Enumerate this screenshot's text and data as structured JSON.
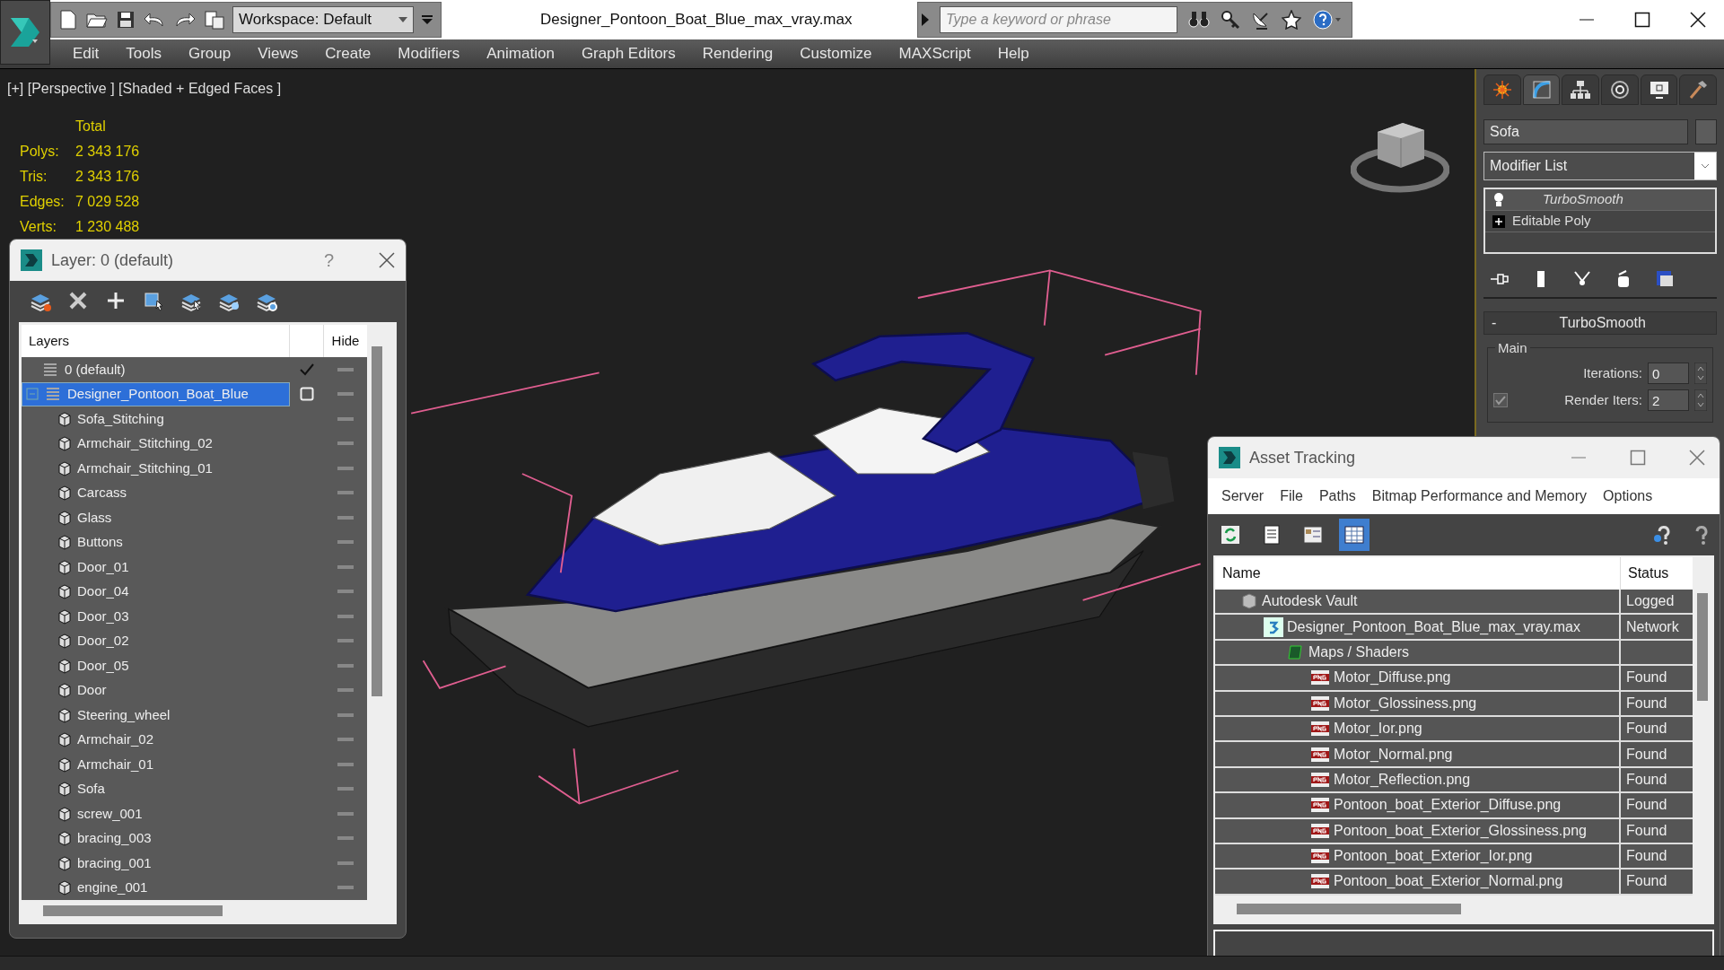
{
  "window": {
    "title": "Designer_Pontoon_Boat_Blue_max_vray.max"
  },
  "workspace": {
    "value": "Workspace: Default"
  },
  "search": {
    "placeholder": "Type a keyword or phrase"
  },
  "menu": [
    "Edit",
    "Tools",
    "Group",
    "Views",
    "Create",
    "Modifiers",
    "Animation",
    "Graph Editors",
    "Rendering",
    "Customize",
    "MAXScript",
    "Help"
  ],
  "viewport": {
    "label": "[+] [Perspective ] [Shaded + Edged Faces ]",
    "stats": {
      "heading": "Total",
      "rows": [
        {
          "label": "Polys:",
          "value": "2 343 176"
        },
        {
          "label": "Tris:",
          "value": "2 343 176"
        },
        {
          "label": "Edges:",
          "value": "7 029 528"
        },
        {
          "label": "Verts:",
          "value": "1 230 488"
        }
      ]
    }
  },
  "layer_dialog": {
    "title": "Layer: 0 (default)",
    "help": "?",
    "columns": [
      "Layers",
      "Hide"
    ],
    "layers": [
      {
        "name": "0 (default)",
        "current": true,
        "selected": false
      },
      {
        "name": "Designer_Pontoon_Boat_Blue",
        "current": false,
        "selected": true,
        "expanded": true,
        "children": [
          {
            "name": "Sofa_Stitching",
            "selected": false
          },
          {
            "name": "Armchair_Stitching_02",
            "selected": false
          },
          {
            "name": "Armchair_Stitching_01",
            "selected": false
          },
          {
            "name": "Carcass",
            "selected": false
          },
          {
            "name": "Glass",
            "selected": false
          },
          {
            "name": "Buttons",
            "selected": false
          },
          {
            "name": "Door_01",
            "selected": false
          },
          {
            "name": "Door_04",
            "selected": false
          },
          {
            "name": "Door_03",
            "selected": false
          },
          {
            "name": "Door_02",
            "selected": false
          },
          {
            "name": "Door_05",
            "selected": false
          },
          {
            "name": "Door",
            "selected": false
          },
          {
            "name": "Steering_wheel",
            "selected": false
          },
          {
            "name": "Armchair_02",
            "selected": false
          },
          {
            "name": "Armchair_01",
            "selected": false
          },
          {
            "name": "Sofa",
            "selected": false
          },
          {
            "name": "screw_001",
            "selected": false
          },
          {
            "name": "bracing_003",
            "selected": false
          },
          {
            "name": "bracing_001",
            "selected": false
          },
          {
            "name": "engine_001",
            "selected": false
          }
        ]
      }
    ]
  },
  "command_panel": {
    "tabs": [
      {
        "selected": false
      },
      {
        "selected": true
      },
      {
        "selected": false
      },
      {
        "selected": false
      },
      {
        "selected": false
      },
      {
        "selected": false
      }
    ],
    "object_name": "Sofa",
    "modifier_list": "Modifier List",
    "stack": [
      {
        "name": "TurboSmooth",
        "kind": "modifier"
      },
      {
        "name": "Editable Poly",
        "kind": "base"
      }
    ],
    "rollout": {
      "title": "TurboSmooth",
      "toggle": "-",
      "group": "Main",
      "fields": [
        {
          "label": "Iterations:",
          "value": "0"
        },
        {
          "label": "Render Iters:",
          "value": "2",
          "checked": true
        }
      ]
    }
  },
  "asset_tracking": {
    "title": "Asset Tracking",
    "menu": [
      "Server",
      "File",
      "Paths",
      "Bitmap Performance and Memory",
      "Options"
    ],
    "toolbar": [
      {
        "selected": false
      },
      {
        "selected": false
      },
      {
        "selected": false
      },
      {
        "selected": true
      }
    ],
    "columns": [
      "Name",
      "Status"
    ],
    "rows": [
      {
        "name": "Autodesk Vault",
        "kind": "vault",
        "status": "Logged",
        "children": [
          {
            "name": "Designer_Pontoon_Boat_Blue_max_vray.max",
            "kind": "scene",
            "status": "Network",
            "children": [
              {
                "name": "Maps / Shaders",
                "kind": "folder",
                "children": [
                  {
                    "name": "Motor_Diffuse.png",
                    "kind": "png",
                    "status": "Found"
                  },
                  {
                    "name": "Motor_Glossiness.png",
                    "kind": "png",
                    "status": "Found"
                  },
                  {
                    "name": "Motor_Ior.png",
                    "kind": "png",
                    "status": "Found"
                  },
                  {
                    "name": "Motor_Normal.png",
                    "kind": "png",
                    "status": "Found"
                  },
                  {
                    "name": "Motor_Reflection.png",
                    "kind": "png",
                    "status": "Found"
                  },
                  {
                    "name": "Pontoon_boat_Exterior_Diffuse.png",
                    "kind": "png",
                    "status": "Found"
                  },
                  {
                    "name": "Pontoon_boat_Exterior_Glossiness.png",
                    "kind": "png",
                    "status": "Found"
                  },
                  {
                    "name": "Pontoon_boat_Exterior_Ior.png",
                    "kind": "png",
                    "status": "Found"
                  },
                  {
                    "name": "Pontoon_boat_Exterior_Normal.png",
                    "kind": "png",
                    "status": "Found"
                  }
                ]
              }
            ]
          }
        ]
      }
    ]
  }
}
